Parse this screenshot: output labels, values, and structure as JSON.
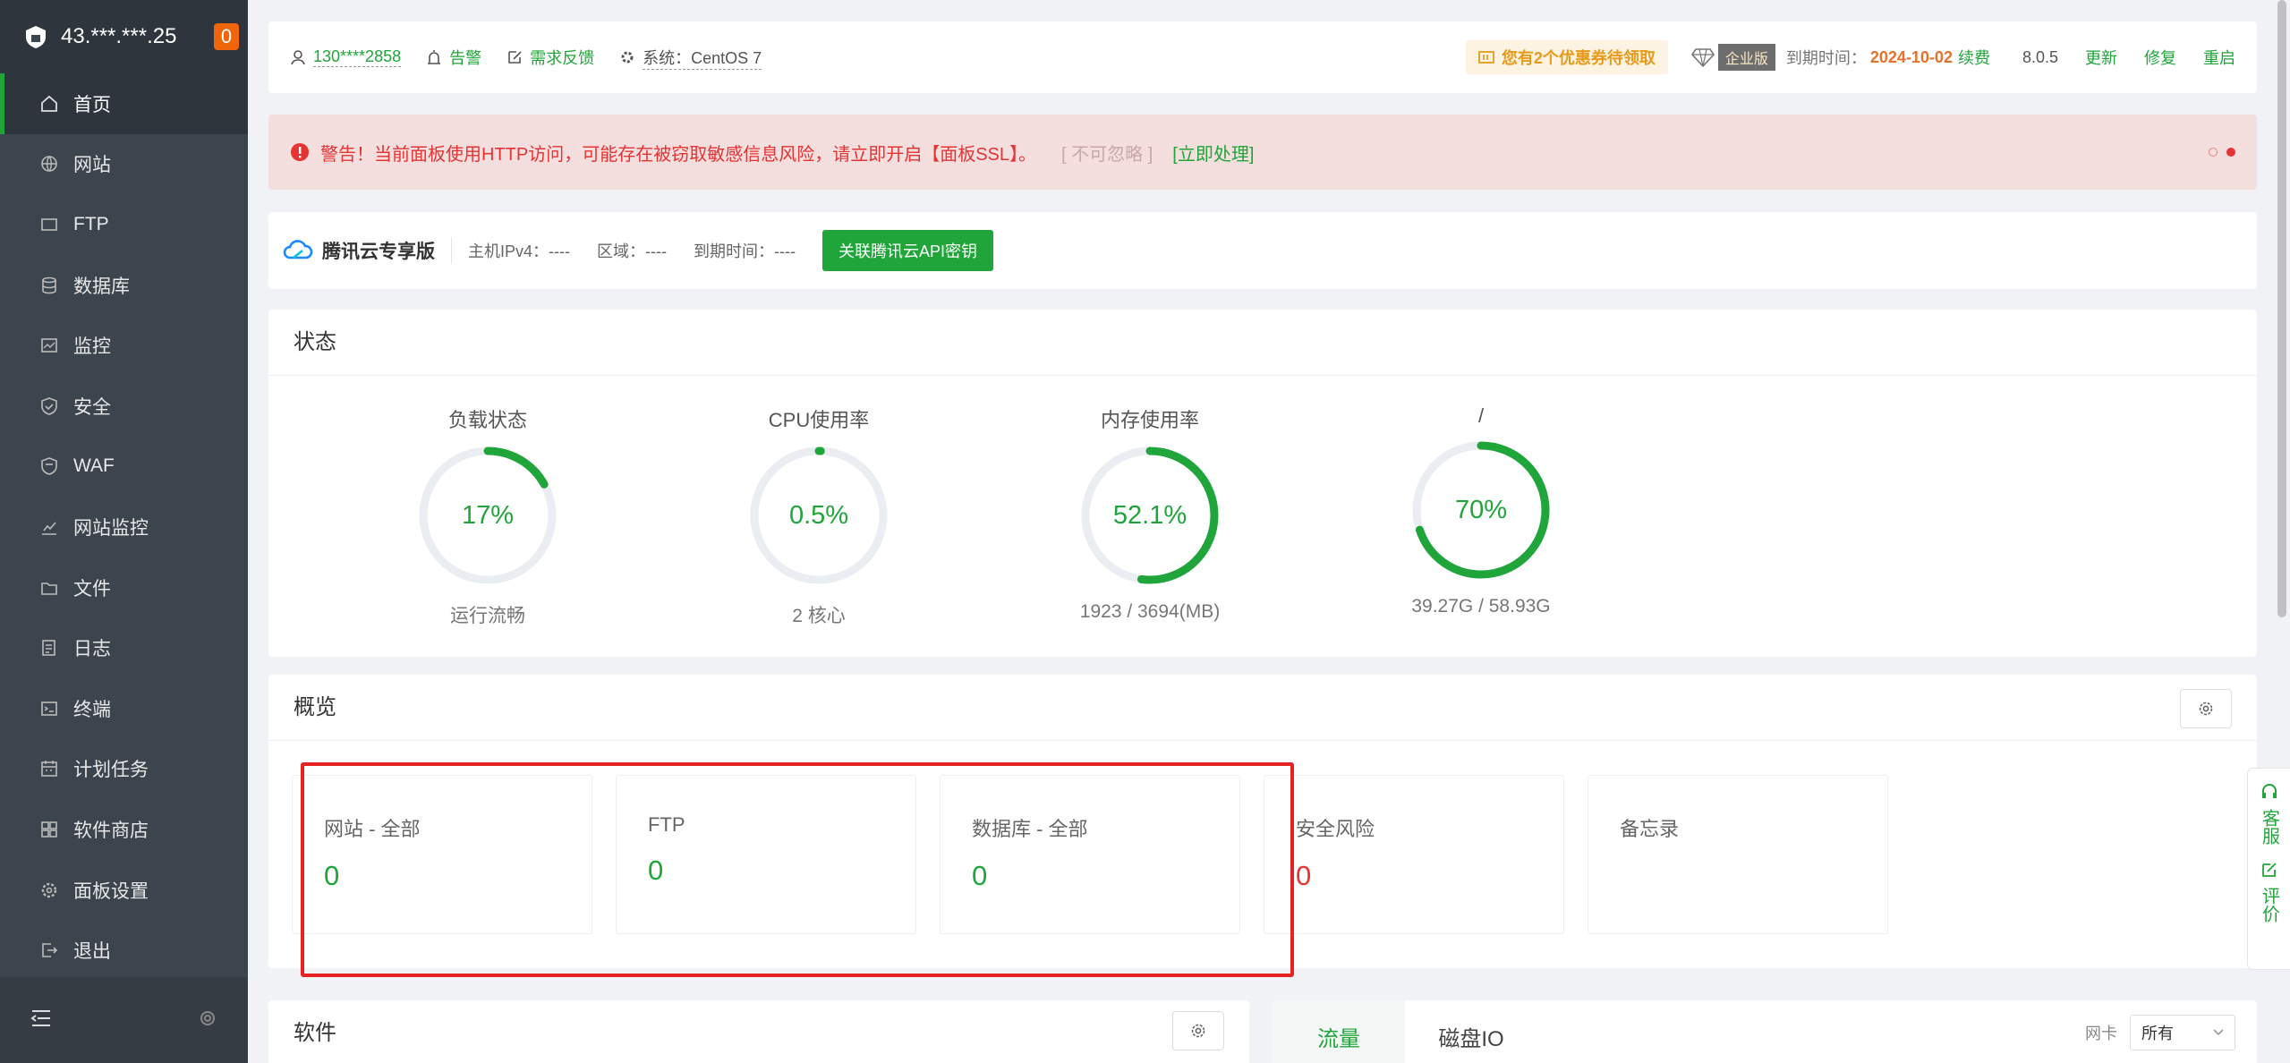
{
  "sidebar": {
    "ip": "43.***.***.25",
    "badge": "0",
    "items": [
      {
        "label": "首页",
        "icon": "home-icon"
      },
      {
        "label": "网站",
        "icon": "globe-icon"
      },
      {
        "label": "FTP",
        "icon": "ftp-icon"
      },
      {
        "label": "数据库",
        "icon": "database-icon"
      },
      {
        "label": "监控",
        "icon": "monitor-icon"
      },
      {
        "label": "安全",
        "icon": "shield-icon"
      },
      {
        "label": "WAF",
        "icon": "waf-icon"
      },
      {
        "label": "网站监控",
        "icon": "chart-icon"
      },
      {
        "label": "文件",
        "icon": "folder-icon"
      },
      {
        "label": "日志",
        "icon": "log-icon"
      },
      {
        "label": "终端",
        "icon": "terminal-icon"
      },
      {
        "label": "计划任务",
        "icon": "calendar-icon"
      },
      {
        "label": "软件商店",
        "icon": "grid-icon"
      },
      {
        "label": "面板设置",
        "icon": "gear-icon"
      },
      {
        "label": "退出",
        "icon": "logout-icon"
      }
    ]
  },
  "topbar": {
    "user": "130****2858",
    "alarm": "告警",
    "feedback": "需求反馈",
    "system": "系统：CentOS 7",
    "coupon": "您有2个优惠券待领取",
    "edition": "企业版",
    "expire_label": "到期时间：",
    "expire_date": "2024-10-02",
    "renew": "续费",
    "version": "8.0.5",
    "update": "更新",
    "repair": "修复",
    "restart": "重启"
  },
  "warning": {
    "text": "警告！当前面板使用HTTP访问，可能存在被窃取敏感信息风险，请立即开启【面板SSL】。",
    "ignore": "[ 不可忽略 ]",
    "handle": "[立即处理]"
  },
  "tencent": {
    "title": "腾讯云专享版",
    "ipv4": "主机IPv4：----",
    "region": "区域：----",
    "expire": "到期时间：----",
    "button": "关联腾讯云API密钥"
  },
  "status": {
    "title": "状态",
    "gauges": [
      {
        "title": "负载状态",
        "value": "17%",
        "sub": "运行流畅",
        "percent": 17
      },
      {
        "title": "CPU使用率",
        "value": "0.5%",
        "sub": "2 核心",
        "percent": 0.5
      },
      {
        "title": "内存使用率",
        "value": "52.1%",
        "sub": "1923 / 3694(MB)",
        "percent": 52.1
      },
      {
        "title": "/",
        "value": "70%",
        "sub": "39.27G / 58.93G",
        "percent": 70
      }
    ]
  },
  "overview": {
    "title": "概览",
    "boxes": [
      {
        "label": "网站 - 全部",
        "value": "0",
        "color": "green"
      },
      {
        "label": "FTP",
        "value": "0",
        "color": "green"
      },
      {
        "label": "数据库 - 全部",
        "value": "0",
        "color": "green"
      },
      {
        "label": "安全风险",
        "value": "0",
        "color": "red"
      },
      {
        "label": "备忘录",
        "value": "",
        "color": "green"
      }
    ]
  },
  "software": {
    "title": "软件"
  },
  "traffic": {
    "tabs": [
      "流量",
      "磁盘IO"
    ],
    "nic_label": "网卡",
    "nic_value": "所有"
  },
  "float": {
    "service": "客服",
    "rate": "评价"
  },
  "colors": {
    "accent": "#20a53a",
    "danger": "#e63333",
    "sidebar": "#3c444d"
  }
}
